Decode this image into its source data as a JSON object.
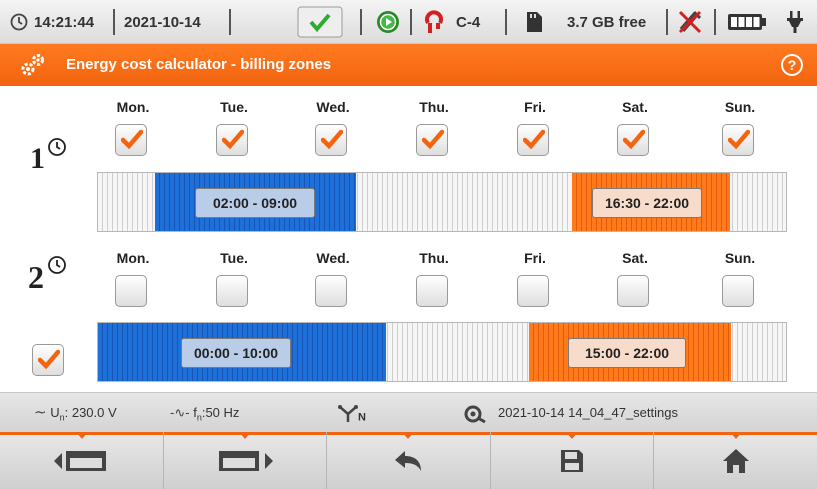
{
  "status": {
    "time": "14:21:44",
    "date": "2021-10-14",
    "clamp": "C-4",
    "storage": "3.7 GB free",
    "icons": [
      "clock-icon",
      "ok-check-icon",
      "recording-icon",
      "clamp-icon",
      "sd-card-icon",
      "usb-disconnected-icon",
      "battery-icon",
      "plug-icon"
    ]
  },
  "header": {
    "title": "Energy cost calculator - billing zones",
    "left_icon": "gears-icon",
    "right_icon": "help-icon",
    "help_symbol": "?"
  },
  "zone1": {
    "number": "1",
    "days": [
      {
        "label": "Mon.",
        "checked": true
      },
      {
        "label": "Tue.",
        "checked": true
      },
      {
        "label": "Wed.",
        "checked": true
      },
      {
        "label": "Thu.",
        "checked": true
      },
      {
        "label": "Fri.",
        "checked": true
      },
      {
        "label": "Sat.",
        "checked": true
      },
      {
        "label": "Sun.",
        "checked": true
      }
    ],
    "ranges": [
      {
        "label": "02:00 - 09:00",
        "color": "#1f6fd8"
      },
      {
        "label": "16:30 - 22:00",
        "color": "#ff7a1a"
      }
    ]
  },
  "zone2": {
    "number": "2",
    "enabled": true,
    "days": [
      {
        "label": "Mon.",
        "checked": false
      },
      {
        "label": "Tue.",
        "checked": false
      },
      {
        "label": "Wed.",
        "checked": false
      },
      {
        "label": "Thu.",
        "checked": false
      },
      {
        "label": "Fri.",
        "checked": false
      },
      {
        "label": "Sat.",
        "checked": false
      },
      {
        "label": "Sun.",
        "checked": false
      }
    ],
    "ranges": [
      {
        "label": "00:00 - 10:00",
        "color": "#1f6fd8"
      },
      {
        "label": "15:00 - 22:00",
        "color": "#ff7a1a"
      }
    ]
  },
  "info": {
    "voltage_prefix": "U",
    "voltage_sub": "n",
    "voltage_value": ": 230.0 V",
    "freq_prefix": "f",
    "freq_sub": "n",
    "freq_value": ":50 Hz",
    "network_sub": "N",
    "settings_file": "2021-10-14 14_04_47_settings"
  },
  "buttons": [
    {
      "name": "prev-screen-button",
      "icon": "arrow-left-screen-icon"
    },
    {
      "name": "next-screen-button",
      "icon": "arrow-right-screen-icon"
    },
    {
      "name": "back-button",
      "icon": "back-arrow-icon"
    },
    {
      "name": "save-button",
      "icon": "floppy-disk-icon"
    },
    {
      "name": "home-button",
      "icon": "home-icon"
    }
  ],
  "colors": {
    "accent": "#f26410",
    "zone_blue": "#1f6fd8",
    "zone_orange": "#ff7a1a",
    "check": "#f26410"
  }
}
